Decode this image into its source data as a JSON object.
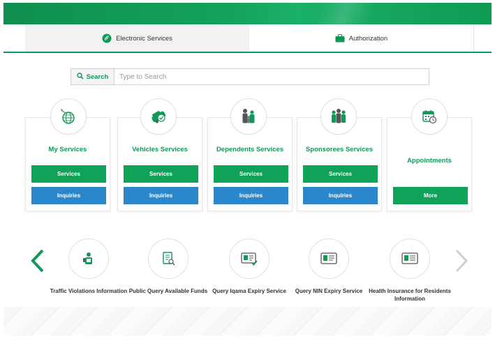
{
  "tabs": [
    {
      "label": "Electronic Services",
      "icon": "leaf-emblem-icon",
      "active": true
    },
    {
      "label": "Authorization",
      "icon": "briefcase-icon",
      "active": false
    }
  ],
  "search": {
    "button_label": "Search",
    "placeholder": "Type to Search"
  },
  "cards": [
    {
      "title": "My Services",
      "icon": "globe-icon",
      "buttons": [
        "Services",
        "Inquiries"
      ]
    },
    {
      "title": "Vehicles Services",
      "icon": "car-check-icon",
      "buttons": [
        "Services",
        "Inquiries"
      ]
    },
    {
      "title": "Dependents Services",
      "icon": "family-icon",
      "buttons": [
        "Services",
        "Inquiries"
      ]
    },
    {
      "title": "Sponsorees Services",
      "icon": "group-icon",
      "buttons": [
        "Services",
        "Inquiries"
      ]
    },
    {
      "title": "Appointments",
      "icon": "calendar-clock-icon",
      "buttons": [
        "More"
      ]
    }
  ],
  "carousel": [
    {
      "label": "Traffic Violations Information",
      "icon": "traffic-officer-icon"
    },
    {
      "label": "Public Query Available Funds",
      "icon": "document-search-icon"
    },
    {
      "label": "Query Iqama Expiry Service",
      "icon": "id-card-check-icon"
    },
    {
      "label": "Query NIN Expiry Service",
      "icon": "id-card-icon"
    },
    {
      "label": "Health Insurance for Residents Information",
      "icon": "insurance-card-icon"
    }
  ],
  "colors": {
    "accent": "#11975a",
    "green_button": "#0fa35a",
    "blue_button": "#2b87ca"
  }
}
